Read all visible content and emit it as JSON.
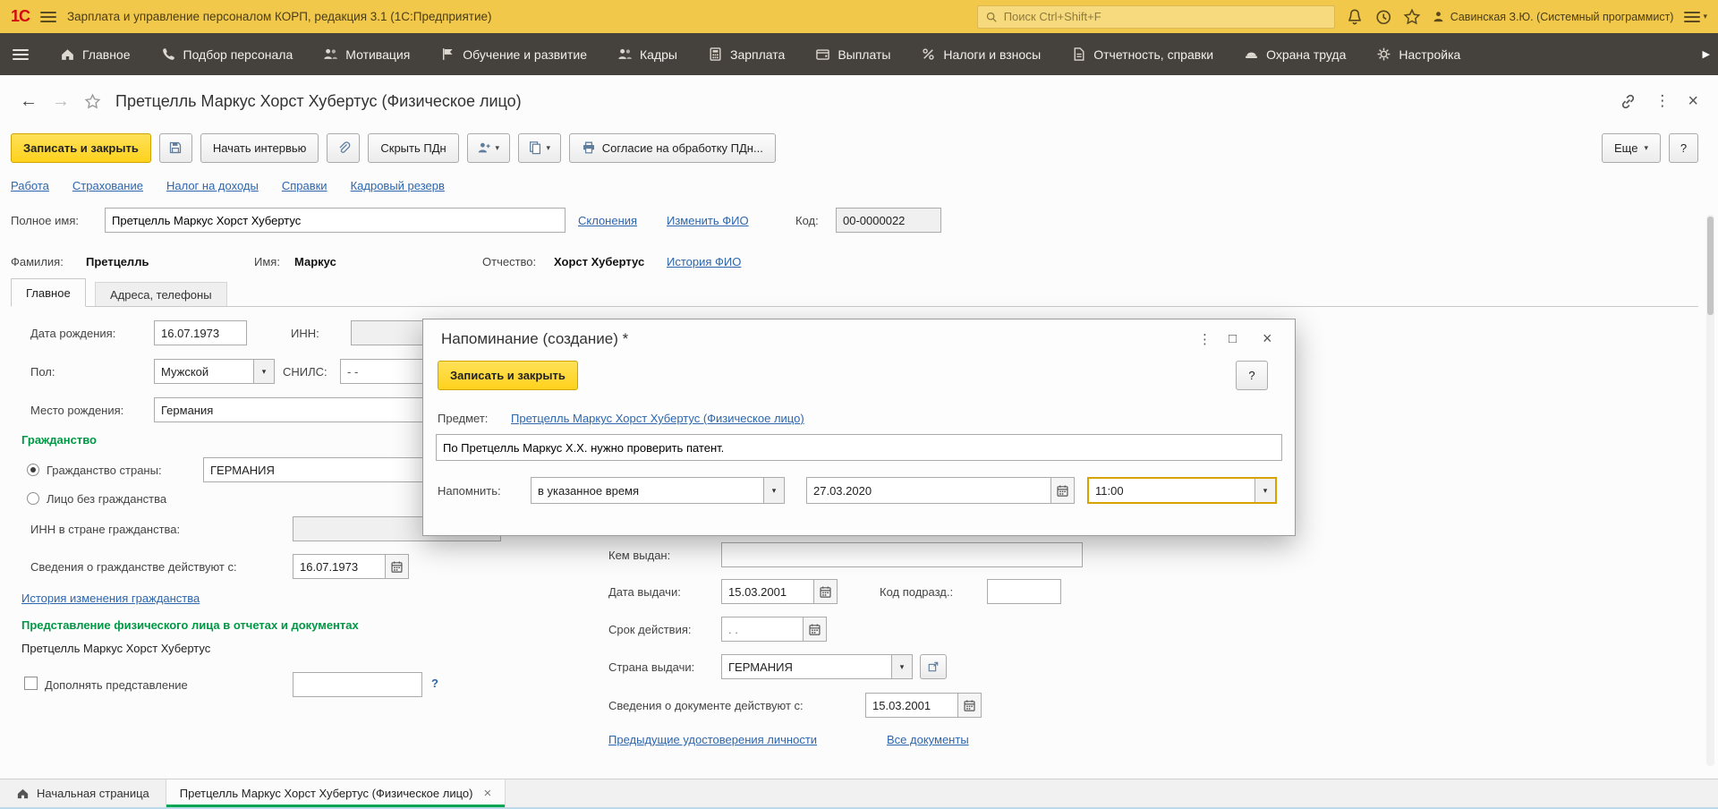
{
  "glyphs": {
    "dropdown": "▾",
    "close": "×",
    "kebab": "⋮",
    "back": "←",
    "forward": "→",
    "maximize": "□",
    "scroll_right": "▶"
  },
  "colors": {
    "topbar_yellow": "#f2c84b",
    "sections_bar": "#45413c",
    "accent_yellow_button": "#ffd21c",
    "link_blue": "#2d66ad",
    "group_green": "#009845",
    "active_tab_green": "#00a651",
    "focus_gold": "#d8a200"
  },
  "titlebar": {
    "logo": "1С",
    "title": "Зарплата и управление персоналом КОРП, редакция 3.1  (1С:Предприятие)",
    "search_placeholder": "Поиск Ctrl+Shift+F",
    "user": "Савинская З.Ю. (Системный программист)"
  },
  "sections": {
    "items": [
      {
        "label": "Главное"
      },
      {
        "label": "Подбор персонала"
      },
      {
        "label": "Мотивация"
      },
      {
        "label": "Обучение и развитие"
      },
      {
        "label": "Кадры"
      },
      {
        "label": "Зарплата"
      },
      {
        "label": "Выплаты"
      },
      {
        "label": "Налоги и взносы"
      },
      {
        "label": "Отчетность, справки"
      },
      {
        "label": "Охрана труда"
      },
      {
        "label": "Настройка"
      }
    ]
  },
  "header": {
    "title": "Претцелль Маркус Хорст Хубертус (Физическое лицо)"
  },
  "toolbar": {
    "save_and_close": "Записать и закрыть",
    "start_interview": "Начать интервью",
    "hide_pdn": "Скрыть ПДн",
    "consent_pdn": "Согласие на обработку ПДн...",
    "more": "Еще",
    "help": "?"
  },
  "nav_links": {
    "items": [
      "Работа",
      "Страхование",
      "Налог на доходы",
      "Справки",
      "Кадровый резерв"
    ]
  },
  "person": {
    "full_name": {
      "label": "Полное имя:",
      "value": "Претцелль Маркус Хорст Хубертус"
    },
    "declension_link": "Склонения",
    "change_name_link": "Изменить ФИО",
    "code": {
      "label": "Код:",
      "value": "00-0000022"
    },
    "last_name": {
      "label": "Фамилия:",
      "value": "Претцелль"
    },
    "first_name": {
      "label": "Имя:",
      "value": "Маркус"
    },
    "middle_name": {
      "label": "Отчество:",
      "value": "Хорст Хубертус"
    },
    "name_history_link": "История ФИО",
    "tabs": [
      {
        "label": "Главное"
      },
      {
        "label": "Адреса, телефоны"
      }
    ],
    "birth_date": {
      "label": "Дата рождения:",
      "value": "16.07.1973"
    },
    "inn": {
      "label": "ИНН:",
      "value": ""
    },
    "gender": {
      "label": "Пол:",
      "value": "Мужской"
    },
    "snils": {
      "label": "СНИЛС:",
      "value": "- -"
    },
    "birth_place": {
      "label": "Место рождения:",
      "value": "Германия"
    },
    "citizenship": {
      "group_title": "Гражданство",
      "country_option": "Гражданство страны:",
      "country_value": "ГЕРМАНИЯ",
      "stateless_option": "Лицо без гражданства",
      "foreign_inn_label": "ИНН в стране гражданства:",
      "valid_from_label": "Сведения о гражданстве действуют с:",
      "valid_from_value": "16.07.1973",
      "history_link": "История изменения гражданства"
    },
    "presentation": {
      "group_title": "Представление физического лица в отчетах и документах",
      "value": "Претцелль Маркус Хорст Хубертус",
      "append_label": "Дополнять представление",
      "append_value": "",
      "help": "?"
    },
    "identity_document": {
      "issued_by": {
        "label": "Кем выдан:",
        "value": ""
      },
      "issue_date": {
        "label": "Дата выдачи:",
        "value": "15.03.2001"
      },
      "dept_code": {
        "label": "Код подразд.:",
        "value": ""
      },
      "valid_until": {
        "label": "Срок действия:",
        "value": ". ."
      },
      "issue_country": {
        "label": "Страна выдачи:",
        "value": "ГЕРМАНИЯ"
      },
      "doc_valid_from": {
        "label": "Сведения о документе действуют с:",
        "value": "15.03.2001"
      },
      "previous_ids_link": "Предыдущие удостоверения личности",
      "all_documents_link": "Все документы"
    }
  },
  "reminder_dialog": {
    "title": "Напоминание (создание) *",
    "save_and_close": "Записать и закрыть",
    "help": "?",
    "subject": {
      "label": "Предмет:",
      "value": "Претцелль Маркус Хорст Хубертус (Физическое лицо)"
    },
    "text": "По Претцелль Маркус Х.Х. нужно проверить патент.",
    "remind": {
      "label": "Напомнить:",
      "mode": "в указанное время",
      "date": "27.03.2020",
      "time": "11:00"
    }
  },
  "taskbar": {
    "home": "Начальная страница",
    "active_tab": "Претцелль Маркус Хорст Хубертус (Физическое лицо)"
  }
}
